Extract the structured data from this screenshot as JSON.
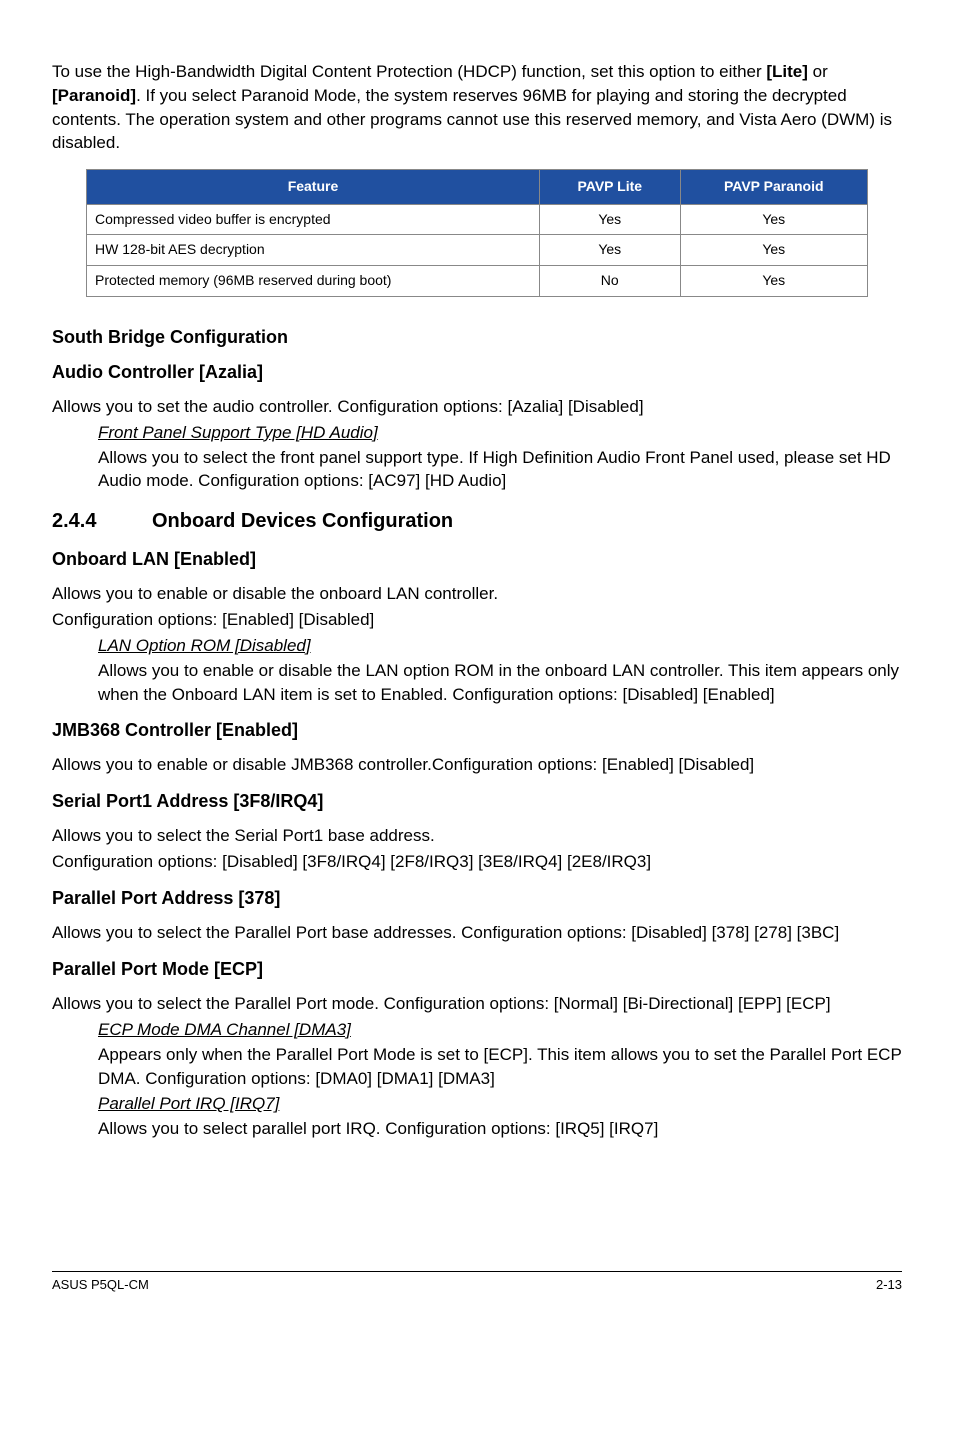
{
  "intro": {
    "pre": "To use the High-Bandwidth Digital Content Protection (HDCP) function, set this option to either ",
    "opt1": "[Lite]",
    "mid": " or ",
    "opt2": "[Paranoid]",
    "post": ". If you select Paranoid Mode, the system reserves 96MB for playing and storing the decrypted contents. The operation system and other programs cannot use this reserved memory, and Vista Aero (DWM) is disabled."
  },
  "table": {
    "headers": {
      "feature": "Feature",
      "lite": "PAVP Lite",
      "paranoid": "PAVP Paranoid"
    },
    "rows": [
      {
        "feature": "Compressed video buffer is encrypted",
        "lite": "Yes",
        "paranoid": "Yes"
      },
      {
        "feature": "HW 128-bit AES decryption",
        "lite": "Yes",
        "paranoid": "Yes"
      },
      {
        "feature": "Protected memory (96MB reserved during boot)",
        "lite": "No",
        "paranoid": "Yes"
      }
    ]
  },
  "south_bridge_heading": "South Bridge Configuration",
  "audio_controller": {
    "heading": "Audio Controller [Azalia]",
    "text": "Allows you to set the audio controller. Configuration options: [Azalia] [Disabled]",
    "sub_heading": "Front Panel Support Type [HD Audio]",
    "sub_text": "Allows you to select the front panel support type. If High Definition Audio Front Panel used, please set HD Audio mode. Configuration options: [AC97] [HD Audio]"
  },
  "onboard_devices": {
    "num": "2.4.4",
    "heading": "Onboard Devices Configuration"
  },
  "onboard_lan": {
    "heading": "Onboard LAN [Enabled]",
    "text1": "Allows you to enable or disable the onboard LAN controller.",
    "text2": "Configuration options: [Enabled] [Disabled]",
    "sub_heading": "LAN Option ROM [Disabled]",
    "sub_text": "Allows you to enable or disable the LAN option ROM in the onboard LAN controller. This item appears only when the Onboard LAN item is set to Enabled. Configuration options: [Disabled] [Enabled]"
  },
  "jmb368": {
    "heading": "JMB368 Controller [Enabled]",
    "text": "Allows you to enable or disable JMB368 controller.Configuration options: [Enabled] [Disabled]"
  },
  "serial_port": {
    "heading": "Serial Port1 Address [3F8/IRQ4]",
    "text1": "Allows you to select the Serial Port1 base address.",
    "text2": "Configuration options: [Disabled] [3F8/IRQ4] [2F8/IRQ3] [3E8/IRQ4] [2E8/IRQ3]"
  },
  "parallel_addr": {
    "heading": "Parallel Port Address [378]",
    "text": "Allows you to select the Parallel Port base addresses. Configuration options: [Disabled] [378] [278] [3BC]"
  },
  "parallel_mode": {
    "heading": "Parallel Port Mode [ECP]",
    "text": "Allows you to select the Parallel Port  mode. Configuration options: [Normal] [Bi-Directional] [EPP] [ECP]",
    "sub1_heading": "ECP Mode DMA Channel [DMA3]",
    "sub1_text": "Appears only when the Parallel Port Mode is set to [ECP]. This item allows you to set the Parallel Port ECP DMA. Configuration options: [DMA0] [DMA1] [DMA3]",
    "sub2_heading": "Parallel Port IRQ [IRQ7]",
    "sub2_text": "Allows you to select parallel port IRQ. Configuration options: [IRQ5] [IRQ7]"
  },
  "footer": {
    "left": "ASUS P5QL-CM",
    "right": "2-13"
  }
}
